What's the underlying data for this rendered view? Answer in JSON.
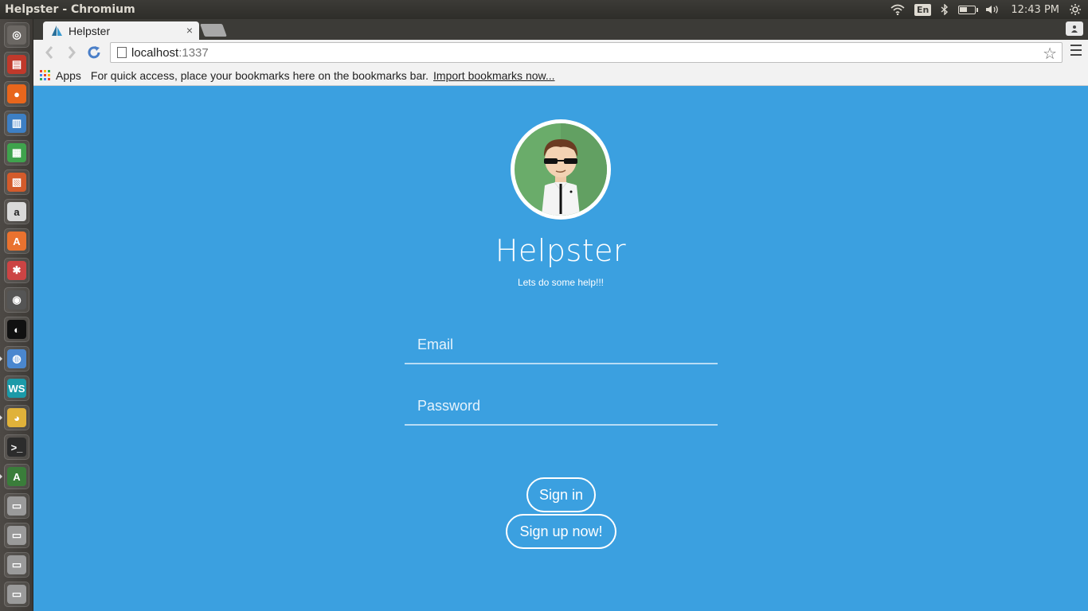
{
  "top_panel": {
    "window_title": "Helpster - Chromium",
    "language": "En",
    "clock": "12:43 PM"
  },
  "launcher": {
    "items": [
      {
        "name": "dash-icon",
        "color": "#6b6763",
        "glyph": "◎"
      },
      {
        "name": "files-icon",
        "color": "#c0392b",
        "glyph": "▤"
      },
      {
        "name": "firefox-icon",
        "color": "#e8661c",
        "glyph": "●"
      },
      {
        "name": "writer-icon",
        "color": "#3d7fc4",
        "glyph": "▥"
      },
      {
        "name": "calc-icon",
        "color": "#3fa34d",
        "glyph": "▦"
      },
      {
        "name": "impress-icon",
        "color": "#d35b2b",
        "glyph": "▧"
      },
      {
        "name": "amazon-icon",
        "color": "#d9d9d9",
        "glyph": "a"
      },
      {
        "name": "software-center-icon",
        "color": "#e9722f",
        "glyph": "A"
      },
      {
        "name": "system-settings-icon",
        "color": "#c44",
        "glyph": "✱"
      },
      {
        "name": "camera-icon",
        "color": "#555",
        "glyph": "◉"
      },
      {
        "name": "terminal-pirate-icon",
        "color": "#111",
        "glyph": "◐"
      },
      {
        "name": "chromium-icon",
        "color": "#4a87cf",
        "glyph": "◍"
      },
      {
        "name": "webstorm-icon",
        "color": "#1b9aa8",
        "glyph": "WS"
      },
      {
        "name": "chrome-icon",
        "color": "#e0b23a",
        "glyph": "◕"
      },
      {
        "name": "terminal-icon",
        "color": "#2c2c2c",
        "glyph": ">_"
      },
      {
        "name": "update-manager-icon",
        "color": "#3a7d3a",
        "glyph": "A"
      },
      {
        "name": "drive-icon",
        "color": "#9a9a9a",
        "glyph": "▭"
      },
      {
        "name": "drive-icon-2",
        "color": "#9a9a9a",
        "glyph": "▭"
      },
      {
        "name": "drive-icon-3",
        "color": "#9a9a9a",
        "glyph": "▭"
      },
      {
        "name": "drive-icon-4",
        "color": "#9a9a9a",
        "glyph": "▭"
      }
    ]
  },
  "browser": {
    "tab_title": "Helpster",
    "tab_close": "×",
    "url_host": "localhost",
    "url_port": ":1337",
    "bookmarks_apps": "Apps",
    "bookmarks_hint": "For quick access, place your bookmarks here on the bookmarks bar.",
    "bookmarks_import": "Import bookmarks now..."
  },
  "page": {
    "background": "#3ba0e0",
    "title": "Helpster",
    "tagline": "Lets do some help!!!",
    "email_placeholder": "Email",
    "password_placeholder": "Password",
    "signin_label": "Sign in",
    "signup_label": "Sign up now!"
  }
}
